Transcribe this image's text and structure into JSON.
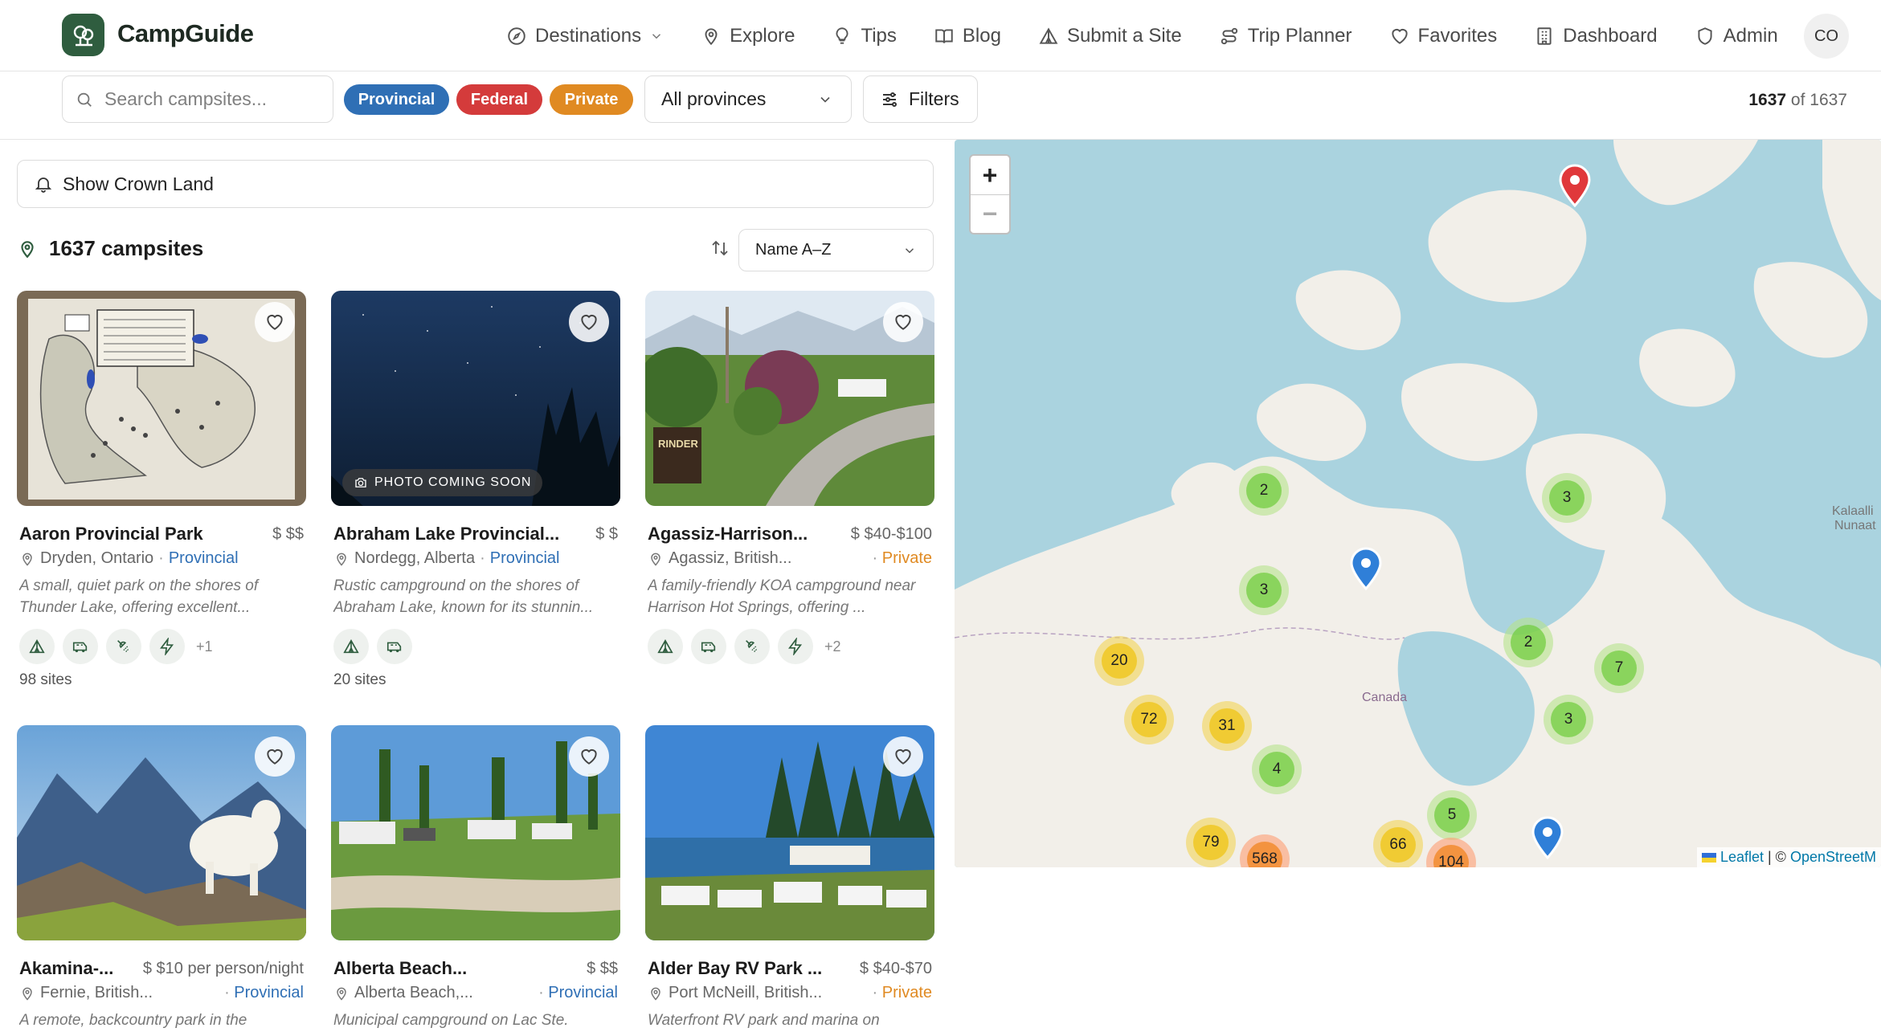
{
  "app": {
    "brand": "CampGuide"
  },
  "nav": [
    {
      "label": "Destinations",
      "icon": "compass-icon"
    },
    {
      "label": "Explore",
      "icon": "map-pin-icon"
    },
    {
      "label": "Tips",
      "icon": "lightbulb-icon"
    },
    {
      "label": "Blog",
      "icon": "book-icon"
    },
    {
      "label": "Submit a Site",
      "icon": "tent-icon"
    },
    {
      "label": "Trip Planner",
      "icon": "route-icon"
    },
    {
      "label": "Favorites",
      "icon": "heart-icon"
    },
    {
      "label": "Dashboard",
      "icon": "building-icon"
    },
    {
      "label": "Admin",
      "icon": "shield-icon"
    }
  ],
  "user": {
    "initials": "CO"
  },
  "toolbar": {
    "search_placeholder": "Search campsites...",
    "filters": {
      "provincial": "Provincial",
      "federal": "Federal",
      "private": "Private"
    },
    "province_select": "All provinces",
    "filters_button": "Filters",
    "count_shown": "1637",
    "count_of": "of 1637"
  },
  "left": {
    "crown_land": "Show Crown Land",
    "results_count": "1637 campsites",
    "sort": "Name A–Z"
  },
  "colors": {
    "provincial": "#2f6fb5",
    "federal": "#d43b3b",
    "private": "#e08a22",
    "brand": "#2f5d3f"
  },
  "cards": [
    {
      "title": "Aaron Provincial Park",
      "price": "$ $$",
      "location": "Dryden, Ontario",
      "type": "Provincial",
      "desc": "A small, quiet park on the shores of Thunder Lake, offering excellent...",
      "extra": "+1",
      "sites": "98 sites"
    },
    {
      "title": "Abraham Lake Provincial...",
      "price": "$ $",
      "location": "Nordegg, Alberta",
      "type": "Provincial",
      "desc": "Rustic campground on the shores of Abraham Lake, known for its stunnin...",
      "extra": "",
      "sites": "20 sites",
      "badge": "PHOTO COMING SOON"
    },
    {
      "title": "Agassiz-Harrison...",
      "price": "$ $40-$100",
      "location": "Agassiz, British...",
      "type": "Private",
      "desc": "A family-friendly KOA campground near Harrison Hot Springs, offering ...",
      "extra": "+2",
      "sites": ""
    },
    {
      "title": "Akamina-...",
      "price": "$ $10 per person/night",
      "location": "Fernie, British...",
      "type": "Provincial",
      "desc": "A remote, backcountry park in the"
    },
    {
      "title": "Alberta Beach...",
      "price": "$ $$",
      "location": "Alberta Beach,...",
      "type": "Provincial",
      "desc": "Municipal campground on Lac Ste."
    },
    {
      "title": "Alder Bay RV Park ...",
      "price": "$ $40-$70",
      "location": "Port McNeill, British...",
      "type": "Private",
      "desc": "Waterfront RV park and marina on"
    }
  ],
  "map": {
    "zoom_in": "+",
    "zoom_out": "−",
    "clusters": [
      "2",
      "3",
      "3",
      "2",
      "7",
      "3",
      "20",
      "72",
      "31",
      "4",
      "5",
      "79",
      "568",
      "66",
      "104"
    ],
    "label_canada": "Canada",
    "label_greenland_1": "Kalaalli",
    "label_greenland_2": "Nunaat",
    "attribution_leaflet": "Leaflet",
    "attribution_sep": " | © ",
    "attribution_osm": "OpenStreetM"
  }
}
